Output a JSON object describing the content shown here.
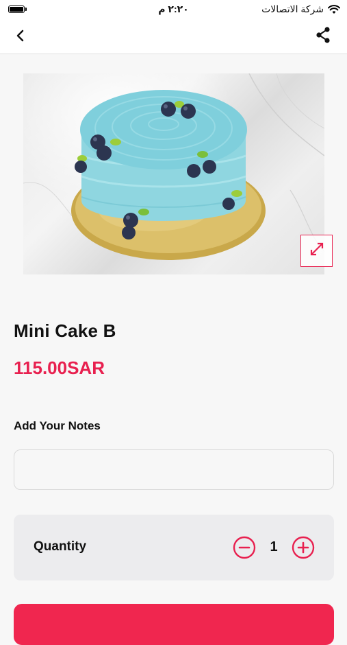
{
  "status_bar": {
    "time": "٢:٢٠ م",
    "carrier": "شركة الاتصالات"
  },
  "nav": {
    "back_icon": "chevron-left-icon",
    "share_icon": "share-icon"
  },
  "product": {
    "name": "Mini Cake B",
    "price": "115.00SAR",
    "image_icon": "expand-icon"
  },
  "notes": {
    "label": "Add Your Notes",
    "value": "",
    "placeholder": ""
  },
  "quantity": {
    "label": "Quantity",
    "value": "1",
    "minus_icon": "minus-circle-icon",
    "plus_icon": "plus-circle-icon"
  },
  "colors": {
    "accent": "#e8204f",
    "background": "#f7f7f7",
    "card": "#ececee"
  }
}
